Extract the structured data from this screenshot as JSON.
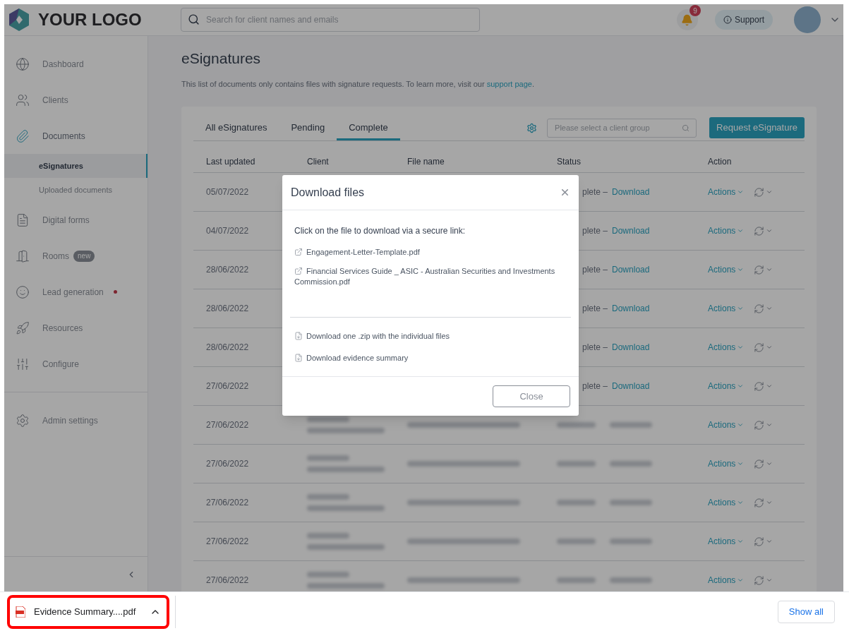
{
  "header": {
    "logo_text": "YOUR LOGO",
    "search": {
      "placeholder": "Search for client names and emails"
    },
    "notification_count": "9",
    "support": "Support"
  },
  "sidebar": {
    "items": [
      {
        "kind": "main",
        "label": "Dashboard",
        "selected": false
      },
      {
        "kind": "main",
        "label": "Clients",
        "selected": false
      },
      {
        "kind": "main",
        "label": "Documents",
        "selected": true
      },
      {
        "kind": "sub",
        "label": "eSignatures",
        "selected": true
      },
      {
        "kind": "sub",
        "label": "Uploaded documents",
        "selected": false
      },
      {
        "kind": "main",
        "label": "Digital forms",
        "selected": false
      },
      {
        "kind": "main",
        "label": "Rooms",
        "badge": "new",
        "selected": false
      },
      {
        "kind": "main",
        "label": "Lead generation",
        "dot": true,
        "selected": false
      },
      {
        "kind": "main",
        "label": "Resources",
        "selected": false
      },
      {
        "kind": "main",
        "label": "Configure",
        "selected": false
      },
      {
        "kind": "divider"
      },
      {
        "kind": "main",
        "label": "Admin settings",
        "selected": false
      }
    ]
  },
  "page": {
    "title": "eSignatures",
    "description": {
      "before": "This list of documents only contains files with signature requests. To learn more, visit our ",
      "link": "support page",
      "after": "."
    }
  },
  "tabs": [
    {
      "label": "All eSignatures",
      "selected": false
    },
    {
      "label": "Pending",
      "selected": false
    },
    {
      "label": "Complete",
      "selected": true
    }
  ],
  "filter": {
    "placeholder": "Please select a client group"
  },
  "request_button": "Request eSignature",
  "table": {
    "columns": [
      "Last updated",
      "Client",
      "File name",
      "Status",
      "Action"
    ],
    "rows": [
      {
        "kind": "covered",
        "date": "05/07/2022",
        "status": "plete –",
        "link": "Download",
        "action": "Actions"
      },
      {
        "kind": "covered",
        "date": "04/07/2022",
        "status": "plete –",
        "link": "Download",
        "action": "Actions"
      },
      {
        "kind": "covered",
        "date": "28/06/2022",
        "status": "plete –",
        "link": "Download",
        "action": "Actions"
      },
      {
        "kind": "covered",
        "date": "28/06/2022",
        "status": "plete –",
        "link": "Download",
        "action": "Actions"
      },
      {
        "kind": "covered",
        "date": "28/06/2022",
        "status": "plete –",
        "link": "Download",
        "action": "Actions"
      },
      {
        "kind": "covered",
        "date": "27/06/2022",
        "status": "plete –",
        "link": "Download",
        "action": "Actions"
      },
      {
        "kind": "blurred",
        "date": "27/06/2022",
        "action": "Actions"
      },
      {
        "kind": "blurred",
        "date": "27/06/2022",
        "action": "Actions"
      },
      {
        "kind": "blurred",
        "date": "27/06/2022",
        "action": "Actions"
      },
      {
        "kind": "blurred",
        "date": "27/06/2022",
        "action": "Actions"
      },
      {
        "kind": "blurred",
        "date": "27/06/2022",
        "action": "Actions"
      }
    ]
  },
  "modal": {
    "title": "Download files",
    "intro": "Click on the file to download via a secure link:",
    "files": [
      "Engagement-Letter-Template.pdf",
      "Financial Services Guide _ ASIC - Australian Securities and Investments Commission.pdf"
    ],
    "downloads": [
      "Download one .zip with the individual files",
      "Download evidence summary"
    ],
    "close": "Close"
  },
  "download_bar": {
    "file": "Evidence Summary....pdf",
    "show_all": "Show all"
  }
}
